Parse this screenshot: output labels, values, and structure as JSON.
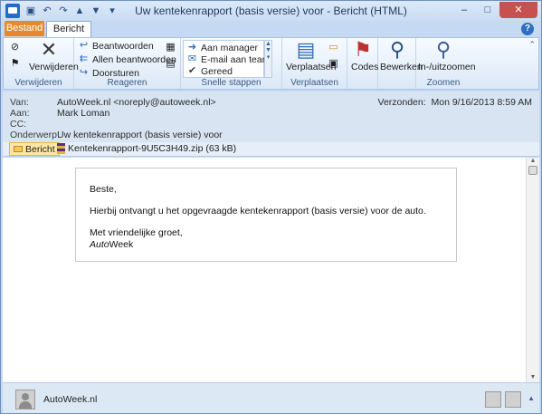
{
  "window": {
    "title": "Uw kentekenrapport (basis versie) voor  -  Bericht (HTML)",
    "controls": {
      "minimize": "–",
      "maximize": "□",
      "close": "✕"
    }
  },
  "tabs": {
    "file": "Bestand",
    "message": "Bericht",
    "help": "?"
  },
  "ribbon": {
    "delete_group": {
      "label": "Verwijderen",
      "delete_button": "Verwijderen"
    },
    "respond_group": {
      "label": "Reageren",
      "reply": "Beantwoorden",
      "reply_all": "Allen beantwoorden",
      "forward": "Doorsturen"
    },
    "quick_steps_group": {
      "label": "Snelle stappen",
      "items": [
        "Aan manager",
        "E-mail aan team",
        "Gereed"
      ]
    },
    "move_group": {
      "label": "Verplaatsen",
      "move_button": "Verplaatsen"
    },
    "tags_group": {
      "codes_button": "Codes"
    },
    "edit_group": {
      "edit_button": "Bewerken"
    },
    "zoom_group": {
      "label": "Zoomen",
      "zoom_button": "In-/uitzoomen"
    }
  },
  "header": {
    "from_label": "Van:",
    "from_value": "AutoWeek.nl <noreply@autoweek.nl>",
    "to_label": "Aan:",
    "to_value": "Mark Loman",
    "cc_label": "CC:",
    "cc_value": "",
    "subject_label": "Onderwerp:",
    "subject_value": "Uw kentekenrapport (basis versie) voor",
    "sent_label": "Verzonden:",
    "sent_value": "Mon 9/16/2013 8:59 AM"
  },
  "attachments": {
    "message_button": "Bericht",
    "file": "Kentekenrapport-9U5C3H49.zip (63 kB)"
  },
  "body": {
    "greeting": "Beste,",
    "text": "Hierbij ontvangt u het opgevraagde kentekenrapport (basis versie) voor de auto.",
    "closing": "Met vriendelijke groet,",
    "sig_italic": "Auto",
    "sig_rest": "Week"
  },
  "people_pane": {
    "name": "AutoWeek.nl"
  }
}
